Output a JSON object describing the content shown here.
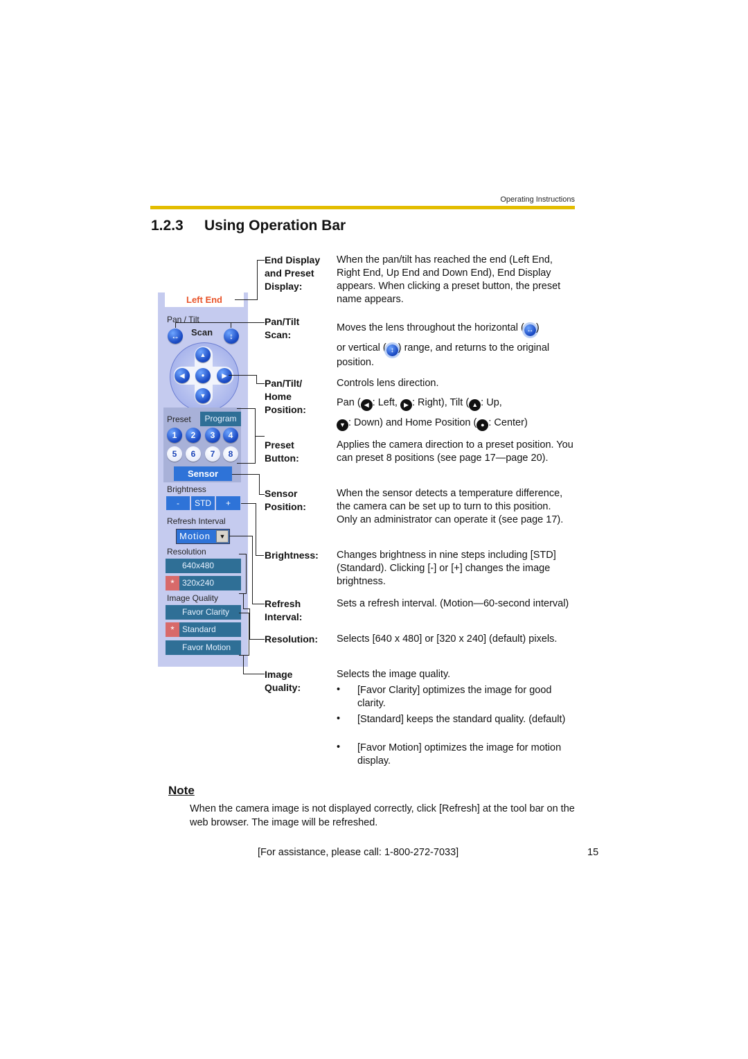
{
  "header": {
    "running_title": "Operating Instructions",
    "accent_color": "#e3bd00"
  },
  "section": {
    "number": "1.2.3",
    "title": "Using Operation Bar"
  },
  "operation_bar": {
    "end_display": "Left End",
    "pan_tilt_label": "Pan / Tilt",
    "scan_label": "Scan",
    "scan_icons": [
      "horizontal-scan-icon",
      "vertical-scan-icon"
    ],
    "dpad": {
      "up": "▲",
      "down": "▼",
      "left": "◀",
      "right": "▶",
      "home": "●"
    },
    "preset_label": "Preset",
    "program_label": "Program",
    "preset_buttons": [
      "1",
      "2",
      "3",
      "4",
      "5",
      "6",
      "7",
      "8"
    ],
    "sensor_label": "Sensor",
    "brightness_label": "Brightness",
    "brightness_buttons": [
      "-",
      "STD",
      "+"
    ],
    "refresh_label": "Refresh Interval",
    "refresh_value": "Motion",
    "resolution_label": "Resolution",
    "resolution_options": [
      {
        "label": "640x480",
        "selected": false
      },
      {
        "label": "320x240",
        "selected": true
      }
    ],
    "quality_label": "Image Quality",
    "quality_options": [
      {
        "label": "Favor Clarity",
        "selected": false
      },
      {
        "label": "Standard",
        "selected": true
      },
      {
        "label": "Favor Motion",
        "selected": false
      }
    ],
    "selected_marker": "*"
  },
  "descriptions": [
    {
      "term_lines": [
        "End Display",
        "and Preset",
        "Display:"
      ],
      "text": "When the pan/tilt has reached the end (Left End, Right End, Up End and Down End), End Display appears. When clicking a preset button, the preset name appears."
    },
    {
      "term_lines": [
        "Pan/Tilt",
        "Scan:"
      ],
      "text_parts": [
        "Moves the lens throughout the horizontal (",
        ")",
        "or vertical (",
        ") range, and returns to the original position."
      ]
    },
    {
      "term_lines": [
        "Pan/Tilt/",
        "Home",
        "Position:"
      ],
      "line1": "Controls lens direction.",
      "line2_parts": [
        "Pan (",
        ": Left, ",
        ": Right), Tilt (",
        ": Up,"
      ],
      "line3_parts": [
        ": Down) and Home Position (",
        ": Center)"
      ]
    },
    {
      "term_lines": [
        "Preset",
        "Button:"
      ],
      "text": "Applies the camera direction to a preset position. You can preset 8 positions (see page 17—page 20)."
    },
    {
      "term_lines": [
        "Sensor",
        "Position:"
      ],
      "text": "When the sensor detects a temperature difference, the camera can be set up to turn to this position. Only an administrator can operate it (see page 17)."
    },
    {
      "term_lines": [
        "Brightness:"
      ],
      "text": "Changes brightness in nine steps including [STD] (Standard). Clicking [-] or [+] changes the image brightness."
    },
    {
      "term_lines": [
        "Refresh",
        "Interval:"
      ],
      "text": "Sets a refresh interval. (Motion—60-second interval)"
    },
    {
      "term_lines": [
        "Resolution:"
      ],
      "text": "Selects [640 x 480] or [320 x 240] (default) pixels."
    },
    {
      "term_lines": [
        "Image",
        "Quality:"
      ],
      "text": "Selects the image quality.",
      "bullets": [
        "[Favor Clarity] optimizes the image for good clarity.",
        "[Standard] keeps the standard quality. (default)",
        "[Favor Motion] optimizes the image for motion display."
      ],
      "bullet_char": "•"
    }
  ],
  "note": {
    "title": "Note",
    "text": "When the camera image is not displayed correctly, click [Refresh] at the tool bar on the web browser. The image will be refreshed."
  },
  "footer": {
    "assistance": "[For assistance, please call: 1-800-272-7033]",
    "page_number": "15"
  }
}
